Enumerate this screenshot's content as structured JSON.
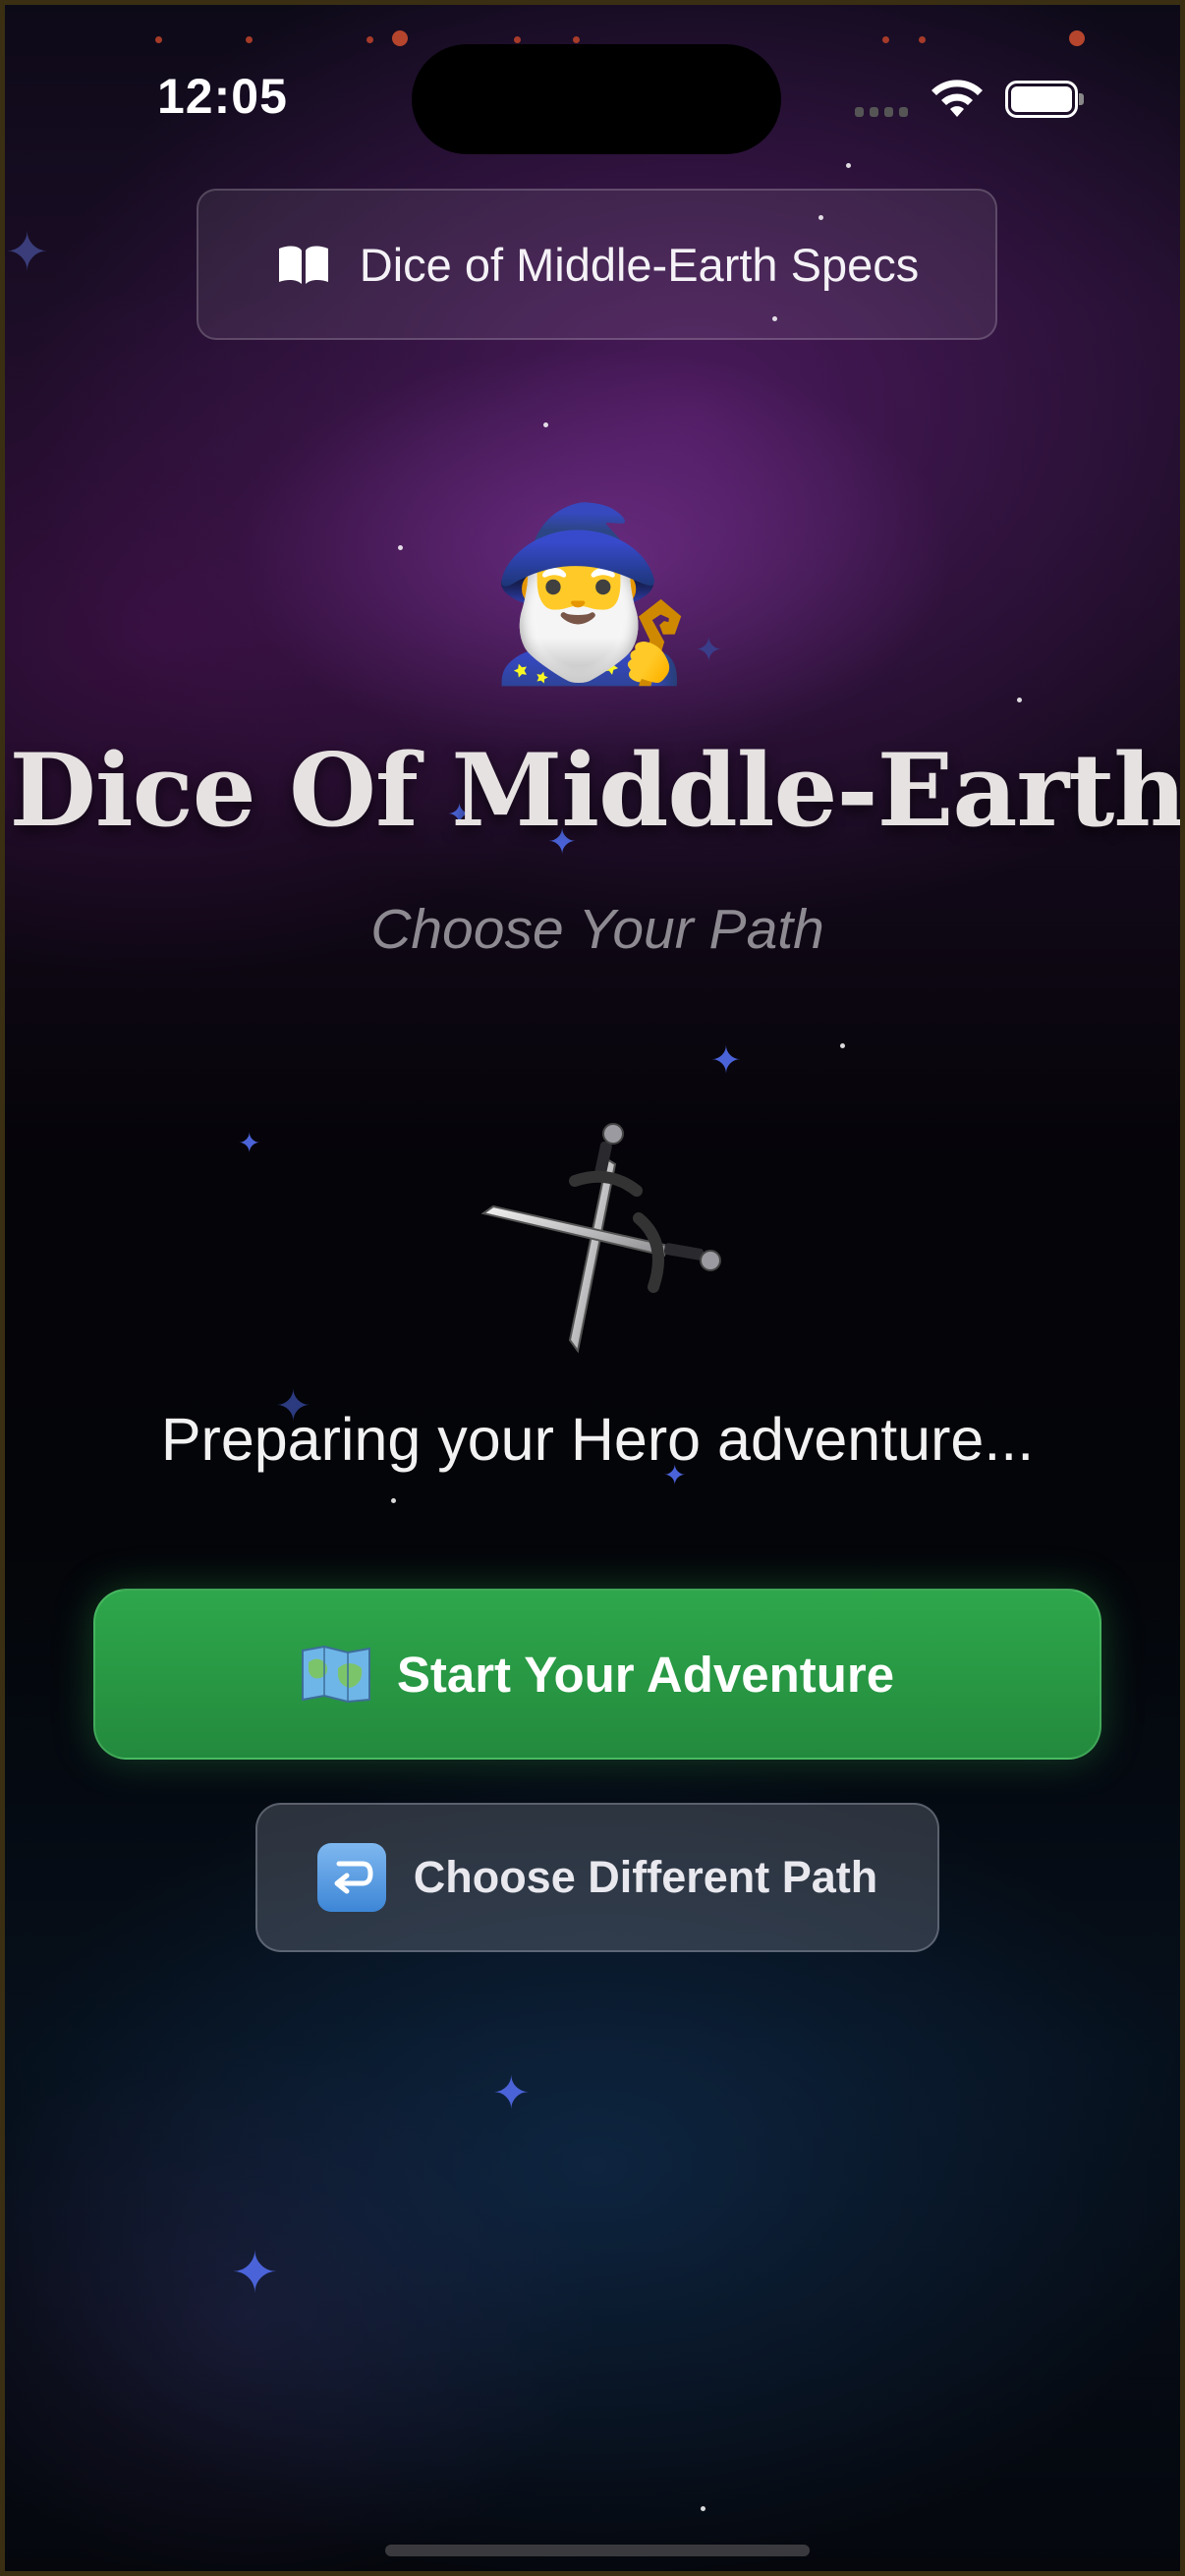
{
  "status_bar": {
    "time": "12:05",
    "icons": [
      "cellular-signal-icon",
      "wifi-icon",
      "battery-icon"
    ]
  },
  "specs_button": {
    "icon": "book-icon",
    "label": "Dice of Middle-Earth Specs"
  },
  "hero": {
    "emoji": "🧙‍♂️",
    "icon": "wizard-icon",
    "title": "Dice Of Middle-Earth",
    "subtitle": "Choose Your Path"
  },
  "loading": {
    "icon": "crossed-swords-icon",
    "message": "Preparing your Hero adventure..."
  },
  "actions": {
    "start": {
      "icon": "map-icon",
      "label": "Start Your Adventure"
    },
    "choose_path": {
      "icon": "return-arrow-icon",
      "label": "Choose Different Path"
    }
  },
  "colors": {
    "start_button": "#2ea74b",
    "sparkle": "#4b63d8",
    "background_purple": "#5a1e6e",
    "background_blue": "#14375f"
  }
}
